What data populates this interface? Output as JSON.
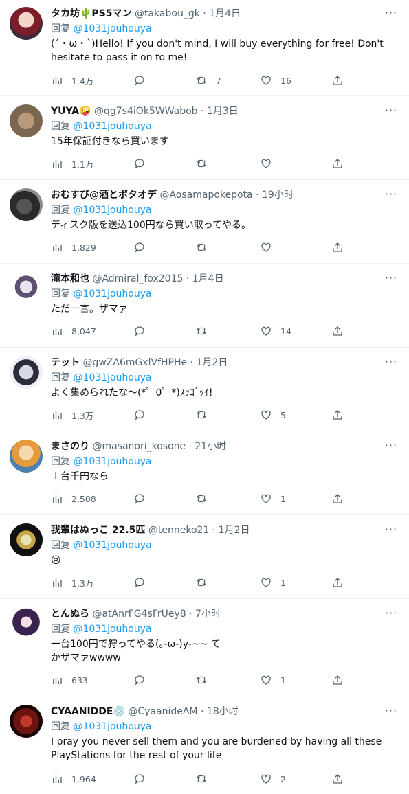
{
  "replies": [
    {
      "name": "タカ坊🌵PS5マン",
      "handle": "@takabou_gk",
      "time": "1月4日",
      "reply_to": "回复",
      "mention": "@1031jouhouya",
      "text": "(´・ω・`)Hello! If you don't mind, I will buy everything for free! Don't hesitate to pass it on to me!",
      "views": "1.4万",
      "retweets": "7",
      "likes": "16"
    },
    {
      "name": "YUYA🤪",
      "handle": "@qg7s4iOk5WWabob",
      "time": "1月3日",
      "reply_to": "回复",
      "mention": "@1031jouhouya",
      "text": "15年保証付きなら買います",
      "views": "1.1万",
      "retweets": "",
      "likes": ""
    },
    {
      "name": "おむすび@酒とポタオデ",
      "handle": "@Aosamapokepota",
      "time": "19小时",
      "reply_to": "回复",
      "mention": "@1031jouhouya",
      "text": "ディスク版を送込100円なら買い取ってやる。",
      "views": "1,829",
      "retweets": "",
      "likes": ""
    },
    {
      "name": "滝本和也",
      "handle": "@Admiral_fox2015",
      "time": "1月4日",
      "reply_to": "回复",
      "mention": "@1031jouhouya",
      "text": "ただ一言。ザマァ",
      "views": "8,047",
      "retweets": "",
      "likes": "14"
    },
    {
      "name": "テット",
      "handle": "@gwZA6mGxlVfHPHe",
      "time": "1月2日",
      "reply_to": "回复",
      "mention": "@1031jouhouya",
      "text": "よく集められたな〜(*゜0゜*)ｽｯｺﾞｯｲ!",
      "views": "1.3万",
      "retweets": "",
      "likes": "5"
    },
    {
      "name": "まさのり",
      "handle": "@masanori_kosone",
      "time": "21小时",
      "reply_to": "回复",
      "mention": "@1031jouhouya",
      "text": "１台千円なら",
      "views": "2,508",
      "retweets": "",
      "likes": "1"
    },
    {
      "name": "我輩はぬっこ 22.5匹",
      "handle": "@tenneko21",
      "time": "1月2日",
      "reply_to": "回复",
      "mention": "@1031jouhouya",
      "text": "😢",
      "views": "1.3万",
      "retweets": "",
      "likes": "1"
    },
    {
      "name": "とんぬら",
      "handle": "@atAnrFG4sFrUey8",
      "time": "7小时",
      "reply_to": "回复",
      "mention": "@1031jouhouya",
      "text": "一台100円で狩ってやる(｡-ω-)y-~~ てかザマァwwww",
      "views": "633",
      "retweets": "",
      "likes": "1"
    },
    {
      "name": "CYAANIDDE💿",
      "handle": "@CyaanideAM",
      "time": "18小时",
      "reply_to": "回复",
      "mention": "@1031jouhouya",
      "text": "I pray you never sell them and you are burdened by having all these PlayStations for the rest of your life",
      "views": "1,964",
      "retweets": "",
      "likes": "2"
    }
  ],
  "dot_sep": "·",
  "more_label": "···"
}
